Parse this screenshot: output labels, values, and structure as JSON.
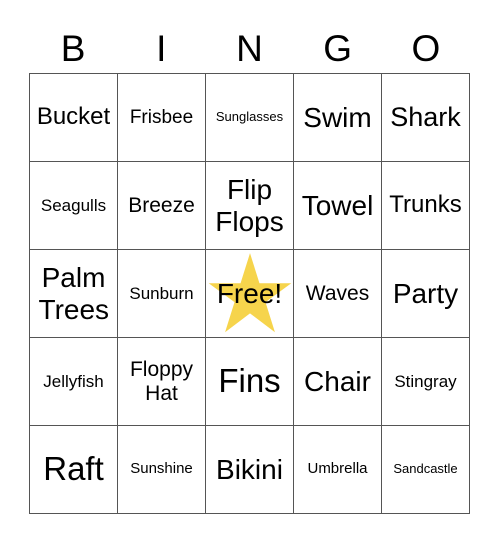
{
  "header": {
    "letters": [
      "B",
      "I",
      "N",
      "G",
      "O"
    ]
  },
  "free_star_color": "#F6D44C",
  "cells": [
    [
      "Bucket",
      "Frisbee",
      "Sunglasses",
      "Swim",
      "Shark"
    ],
    [
      "Seagulls",
      "Breeze",
      "Flip Flops",
      "Towel",
      "Trunks"
    ],
    [
      "Palm Trees",
      "Sunburn",
      "Free!",
      "Waves",
      "Party"
    ],
    [
      "Jellyfish",
      "Floppy Hat",
      "Fins",
      "Chair",
      "Stingray"
    ],
    [
      "Raft",
      "Sunshine",
      "Bikini",
      "Umbrella",
      "Sandcastle"
    ]
  ]
}
